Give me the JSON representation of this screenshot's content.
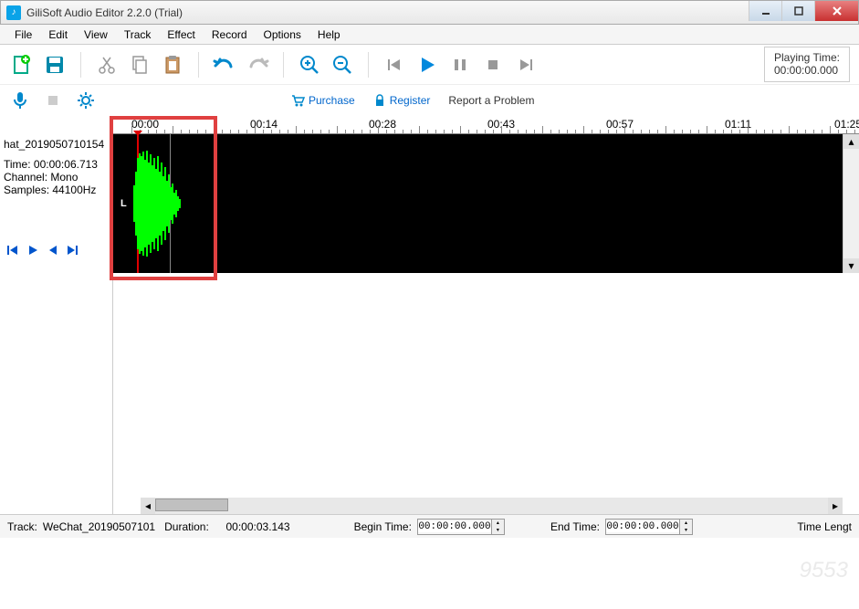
{
  "window": {
    "title": "GiliSoft Audio Editor 2.2.0 (Trial)"
  },
  "menu": [
    "File",
    "Edit",
    "View",
    "Track",
    "Effect",
    "Record",
    "Options",
    "Help"
  ],
  "toolbar_icons": {
    "new": "new-file-icon",
    "save": "save-icon",
    "cut": "scissors-icon",
    "copy": "copy-icon",
    "paste": "paste-icon",
    "undo": "undo-icon",
    "redo": "redo-icon",
    "zoomin": "zoom-in-icon",
    "zoomout": "zoom-out-icon",
    "prev": "skip-prev-icon",
    "play": "play-icon",
    "pause": "pause-icon",
    "stop": "stop-icon",
    "next": "skip-next-icon"
  },
  "playing_time": {
    "label": "Playing Time:",
    "value": "00:00:00.000"
  },
  "toolbar2_icons": {
    "mic": "microphone-icon",
    "stop2": "stop-square-icon",
    "gear": "gear-icon"
  },
  "links": {
    "purchase": "Purchase",
    "register": "Register",
    "report": "Report a Problem"
  },
  "ruler_times": [
    "00:00",
    "00:14",
    "00:28",
    "00:43",
    "00:57",
    "01:11",
    "01:25"
  ],
  "sidepanel": {
    "filename": "hat_2019050710154",
    "time_label": "Time:",
    "time_value": "00:00:06.713",
    "channel_label": "Channel:",
    "channel_value": "Mono",
    "samples_label": "Samples:",
    "samples_value": "44100Hz"
  },
  "channel_letter": "L",
  "status": {
    "track_label": "Track:",
    "track_value": "WeChat_20190507101",
    "duration_label": "Duration:",
    "duration_value": "00:00:03.143",
    "begin_label": "Begin Time:",
    "begin_value": "00:00:00.000",
    "end_label": "End Time:",
    "end_value": "00:00:00.000",
    "length_label": "Time Lengt"
  },
  "watermark": "9553"
}
